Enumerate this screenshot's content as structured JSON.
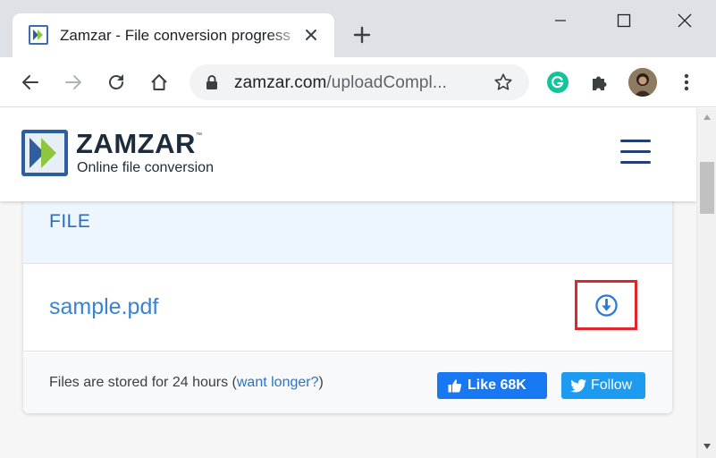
{
  "browser": {
    "tab_title": "Zamzar - File conversion progress",
    "url_host": "zamzar.com",
    "url_path": "/uploadCompl..."
  },
  "icons": {
    "favicon": "zamzar-favicon",
    "tab_close": "close-icon",
    "new_tab": "plus-icon",
    "back": "arrow-left-icon",
    "forward": "arrow-right-icon",
    "reload": "reload-icon",
    "home": "home-icon",
    "lock": "lock-icon",
    "bookmark": "star-icon",
    "grammarly": "grammarly-icon",
    "extensions": "puzzle-icon",
    "menu": "kebab-menu-icon",
    "hamburger": "hamburger-icon",
    "download": "download-icon",
    "facebook": "thumbs-up-icon",
    "twitter": "twitter-bird-icon"
  },
  "site": {
    "logo_name": "ZAMZAR",
    "logo_tm": "™",
    "logo_tagline": "Online file conversion"
  },
  "files": {
    "column_header": "FILE",
    "rows": [
      {
        "name": "sample.pdf"
      }
    ]
  },
  "footer": {
    "retention_prefix": "Files are stored for 24 hours (",
    "retention_link": "want longer?",
    "retention_suffix": ")",
    "like_label": "Like 68K",
    "follow_label": "Follow"
  },
  "colors": {
    "accent_blue": "#2b6cbf",
    "link_blue": "#3b82d0",
    "highlight_red": "#e0252b",
    "facebook_blue": "#1877f2",
    "twitter_blue": "#1d9bf0"
  }
}
